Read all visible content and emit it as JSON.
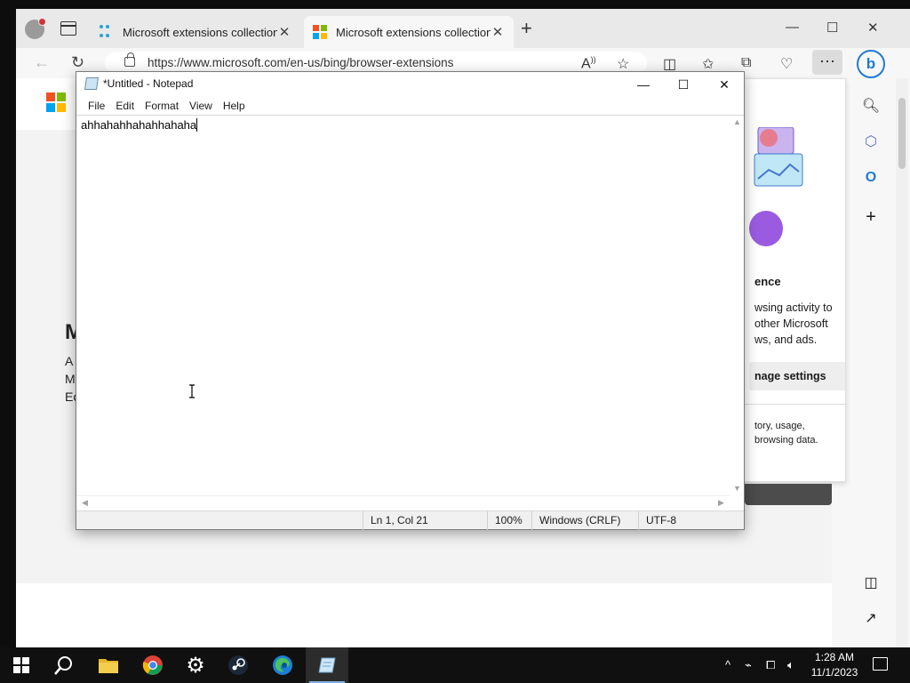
{
  "browser": {
    "tabs": [
      {
        "label": "Microsoft extensions collection",
        "active": false,
        "favicon": "extensions-dots-icon"
      },
      {
        "label": "Microsoft extensions collection",
        "active": true,
        "favicon": "microsoft-logo-icon"
      }
    ],
    "url": "https://www.microsoft.com/en-us/bing/browser-extensions",
    "page": {
      "hero_title": "M",
      "hero_lines": [
        "A",
        "M",
        "Ec"
      ],
      "popup": {
        "heading": "ence",
        "text": "wsing activity to\nother Microsoft\nws, and ads.",
        "button": "nage settings",
        "text2": "tory, usage,\nbrowsing data."
      }
    },
    "colors": {
      "accent": "#1f7ad4",
      "ms_red": "#f25022",
      "ms_green": "#7fba00",
      "ms_blue": "#00a4ef",
      "ms_yellow": "#ffb900"
    }
  },
  "notepad": {
    "title": "*Untitled - Notepad",
    "menu": [
      "File",
      "Edit",
      "Format",
      "View",
      "Help"
    ],
    "content": "ahhahahhahahhahaha",
    "status": {
      "position": "Ln 1, Col 21",
      "zoom": "100%",
      "line_endings": "Windows (CRLF)",
      "encoding": "UTF-8"
    }
  },
  "taskbar": {
    "apps": [
      "start-icon",
      "search-icon",
      "file-explorer-icon",
      "chrome-icon",
      "settings-icon",
      "steam-icon",
      "edge-icon",
      "notepad-icon"
    ],
    "time": "1:28 AM",
    "date": "11/1/2023"
  }
}
